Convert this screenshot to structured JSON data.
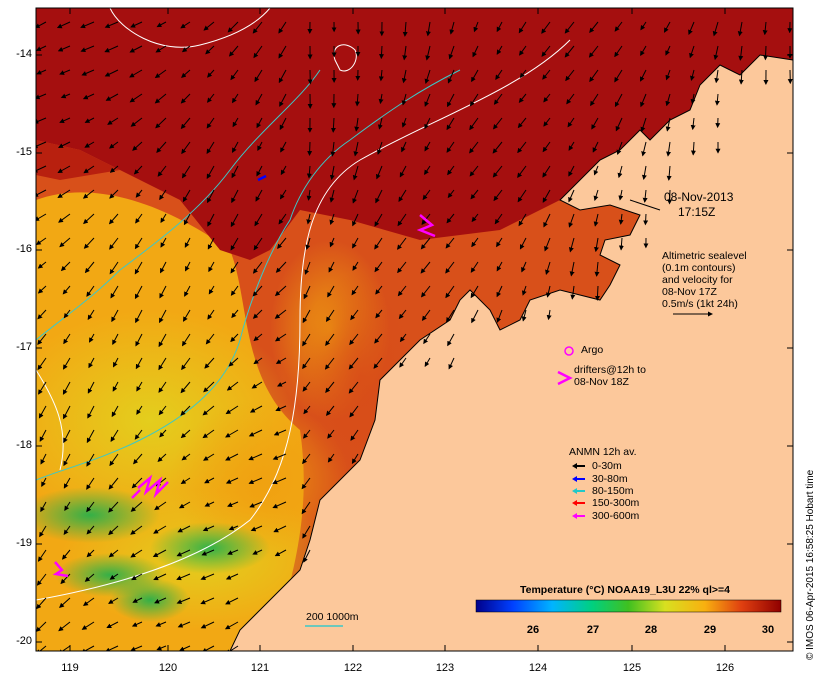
{
  "map": {
    "type": "sea-surface-temperature-map",
    "x_ticks": [
      "119",
      "120",
      "121",
      "122",
      "123",
      "124",
      "125",
      "126"
    ],
    "y_ticks": [
      "-14",
      "-15",
      "-16",
      "-17",
      "-18",
      "-19",
      "-20"
    ],
    "colors": {
      "land": "#fcc89b",
      "hot": "#a50f0f",
      "warm": "#d8501a",
      "mid": "#f2a814",
      "cool": "#e9dc1c",
      "cold": "#2fb44a",
      "contour_white": "#ffffff",
      "isobath": "#3cc8c8"
    }
  },
  "date_label": {
    "line1": "08-Nov-2013",
    "line2": "17:15Z"
  },
  "altimetry_note": {
    "lines": [
      "Altimetric sealevel",
      "(0.1m contours)",
      "and velocity for",
      "08-Nov 17Z",
      "0.5m/s (1kt 24h)"
    ]
  },
  "argo": {
    "label": "Argo"
  },
  "drifters": {
    "lines": [
      "drifters@12h to",
      "08-Nov 18Z"
    ]
  },
  "anmn": {
    "title": "ANMN 12h av.",
    "items": [
      {
        "label": "0-30m",
        "color": "#000000"
      },
      {
        "label": "30-80m",
        "color": "#0000ff"
      },
      {
        "label": "80-150m",
        "color": "#22c8c8"
      },
      {
        "label": "150-300m",
        "color": "#ff0000"
      },
      {
        "label": "300-600m",
        "color": "#ff00ff"
      }
    ]
  },
  "isobath_label": "200  1000m",
  "colorbar": {
    "title": "Temperature (°C) NOAA19_L3U 22% ql>=4",
    "ticks": [
      "26",
      "27",
      "28",
      "29",
      "30"
    ]
  },
  "credit": "© IMOS 06-Apr-2015 16:58:25 Hobart time"
}
